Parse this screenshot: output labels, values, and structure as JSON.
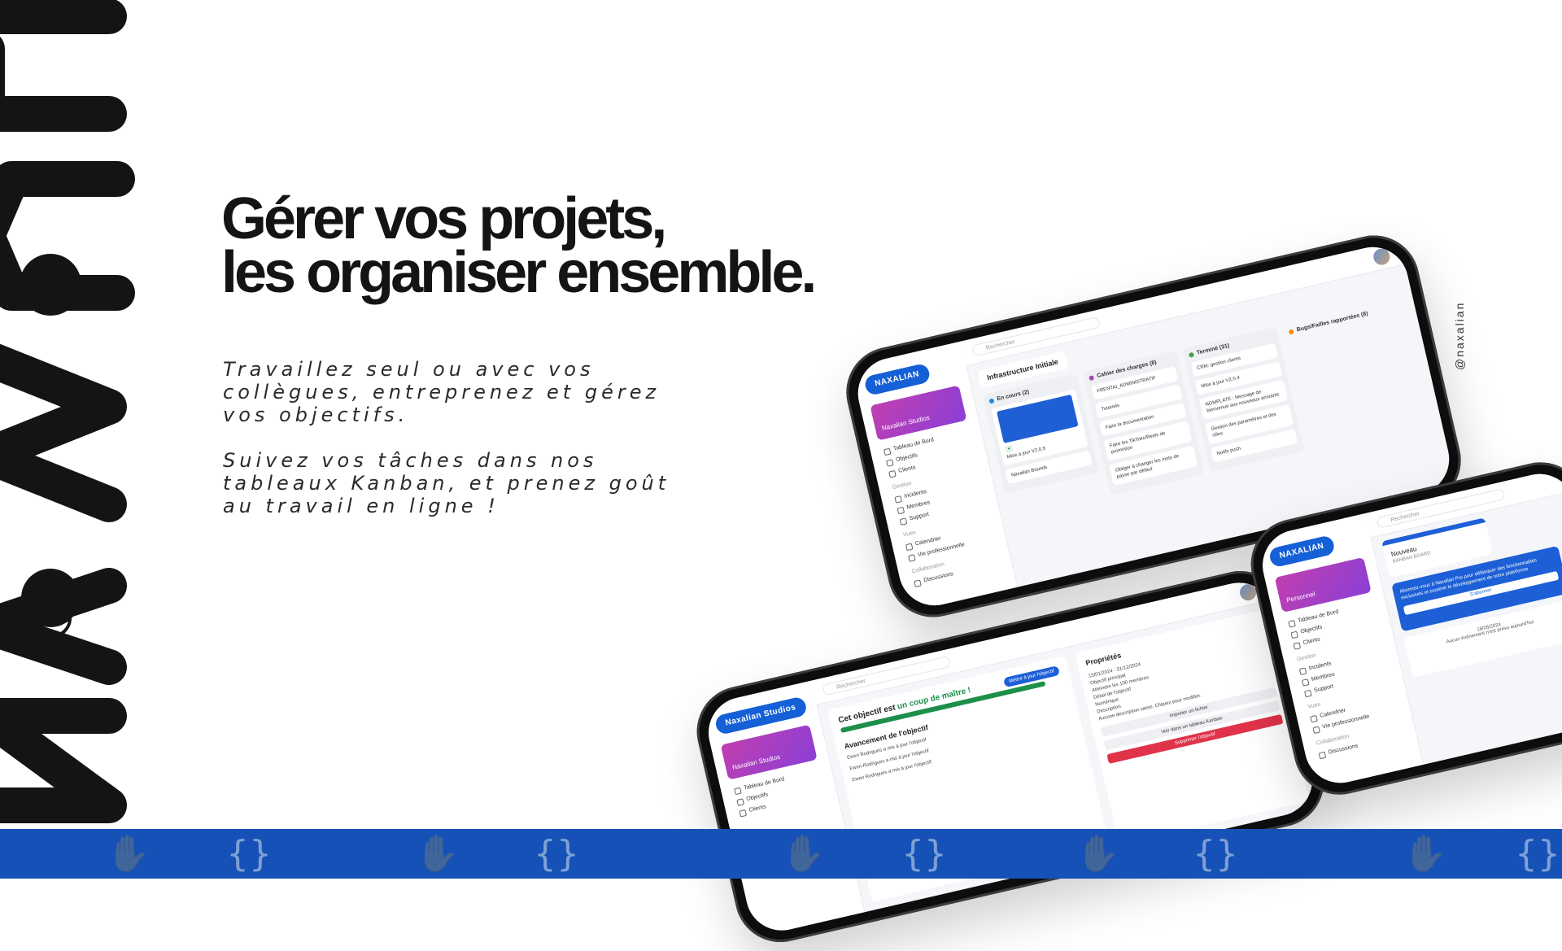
{
  "brand": {
    "logo_text": "NAXALIAN",
    "handle": "@naxalian",
    "colors": {
      "primary_blue": "#1551b6",
      "text_dark": "#141414"
    }
  },
  "headline": {
    "line1": "Gérer vos projets,",
    "line2": "les organiser ensemble."
  },
  "body": {
    "paragraph1": "Travaillez seul ou avec vos collègues, entreprenez et gérez vos objectifs.",
    "paragraph2": "Suivez vos tâches dans nos tableaux Kanban, et prenez goût au travail en ligne !"
  },
  "footer": {
    "icons": [
      "handshake-icon",
      "brace-icon"
    ]
  },
  "phone_kanban": {
    "logo": "NAXALIAN",
    "search_placeholder": "Rechercher",
    "workspace": "Naxalian Studios",
    "nav": [
      "Tableau de Bord",
      "Objectifs",
      "Clients",
      "Gestion",
      "Incidents",
      "Membres",
      "Support",
      "Vues",
      "Calendrier",
      "Vie professionnelle",
      "Collaboration",
      "Discussions"
    ],
    "board_title": "Infrastructure Initiale",
    "columns": [
      {
        "name": "En cours (2)",
        "dot": "#1e88e5",
        "cards": [
          "Mise à jour V2.0.5",
          "Naxalian Bounds"
        ]
      },
      {
        "name": "Cahier des charges (8)",
        "dot": "#ab47bc",
        "cards": [
          "FRENTAI_ADMINISTRATIF",
          "Tutoriels",
          "Faire la documentation",
          "Faire les TikToks/Reels de promotion",
          "Obliger à changer les mots de passe par défaut"
        ]
      },
      {
        "name": "Terminé (31)",
        "dot": "#43a047",
        "cards": [
          "CRM: gestion clients",
          "Mise à jour V2.0.4",
          "NOMPLATE : Message de bienvenue aux nouveaux arrivants",
          "Gestion des paramètres et des rôles",
          "Notifs push"
        ]
      },
      {
        "name": "Bugs/Failles rapportées (8)",
        "dot": "#fb8c00",
        "cards": []
      }
    ]
  },
  "phone_objective": {
    "logo": "Naxalian Studios",
    "search_placeholder": "Rechercher",
    "workspace": "Naxalian Studios",
    "nav": [
      "Tableau de Bord",
      "Objectifs",
      "Clients"
    ],
    "title_prefix": "Cet objectif est",
    "title_highlight": "un coup de maître !",
    "progress": 1.0,
    "update_button": "Mettre à jour l'objectif",
    "section_title": "Avancement de l'objectif",
    "entries": [
      "Ewen Rodrigues a mis à jour l'objectif",
      "Ewen Rodrigues a mis à jour l'objectif",
      "Ewen Rodrigues a mis à jour l'objectif"
    ],
    "props_title": "Propriétés",
    "props": [
      "Objectif principal",
      "Atteindre les 100 membres",
      "Détail de l'objectif",
      "Numérique",
      "Description",
      "Aucune description saisie. Cliquez pour modifier."
    ],
    "dates": "15/01/2024 - 31/12/2024",
    "btn_import": "Importer un fichier",
    "btn_kanban": "Voir dans un tableau Kanban",
    "btn_delete": "Supprimer l'objectif"
  },
  "phone_third": {
    "logo": "NAXALIAN",
    "search_placeholder": "Rechercher",
    "workspace": "Personnel",
    "nav": [
      "Tableau de Bord",
      "Objectifs",
      "Clients",
      "Gestion",
      "Incidents",
      "Membres",
      "Support",
      "Vues",
      "Calendrier",
      "Vie professionnelle",
      "Collaboration",
      "Discussions"
    ],
    "new_label": "Nouveau",
    "new_sub": "KANBAN BOARD",
    "pro_text": "Abonnez-vous à Naxalian Pro pour débloquer des fonctionnalités exclusives et soutenir le développement de notre plateforme",
    "pro_button": "S'abonner",
    "date": "18/05/2024",
    "no_event": "Aucun événement n'est prévu aujourd'hui"
  }
}
